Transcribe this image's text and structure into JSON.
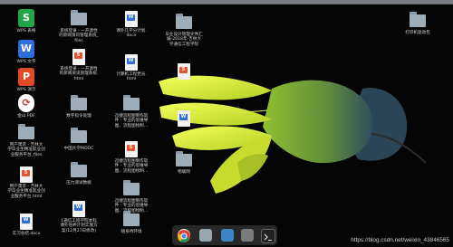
{
  "desktop": {
    "icons": [
      {
        "label": "WPS 表格",
        "type": "app",
        "color": "#22a447",
        "glyph": "S"
      },
      {
        "label": "WPS 文字",
        "type": "app",
        "color": "#2f6fdc",
        "glyph": "W"
      },
      {
        "label": "WPS 演示",
        "type": "app",
        "color": "#e24b27",
        "glyph": "P"
      },
      {
        "label": "金山 PDF",
        "type": "app",
        "color": "#d9322e",
        "glyph": "⟳"
      },
      {
        "label": "用户需求 - 吉林大\n学毕业生精准就业创\n业服务平台_files",
        "type": "folder"
      },
      {
        "label": "用户需求 - 吉林大\n学毕业生精准就业创\n业服务平台.html",
        "type": "html"
      },
      {
        "label": "实习总结.docx",
        "type": "word"
      },
      {
        "label": "系统登录 - 一开源性\n的新闻资讯管理系统_\nfiles",
        "type": "folder"
      },
      {
        "label": "系统登录 - 一开源性\n的新闻资讯管理系统.\nhtml",
        "type": "html"
      },
      {
        "label": "数字指令处理",
        "type": "folder"
      },
      {
        "label": "中国大学MOOC",
        "type": "folder"
      },
      {
        "label": "压力测试数据",
        "type": "folder"
      },
      {
        "label": "1通信工程学院本科\n课外培养计划实施方\n案(12月27日修改)",
        "type": "word"
      },
      {
        "label": "课外几学分计划.\ndocx",
        "type": "word"
      },
      {
        "label": "计算机工程党员.\nhtml",
        "type": "html"
      },
      {
        "label": "迅捷流程图制作软\n件 - 专业的思维导\n图、流程图绘制...",
        "type": "folder"
      },
      {
        "label": "迅捷流程图制作软\n件 - 专业的思维导\n图、流程图绘制...",
        "type": "html"
      },
      {
        "label": "迅捷流程图制作软\n件 - 专业的思维导\n图、流程图绘制...",
        "type": "folder"
      },
      {
        "label": "随身待环境",
        "type": "folder"
      },
      {
        "label": "毕业设计管理文件汇\n编-2018年-吉林大\n学通信工程学院",
        "type": "folder"
      },
      {
        "label": "物联网",
        "type": "folder"
      },
      {
        "label": "打印机驱动包",
        "type": "folder"
      }
    ]
  },
  "dock": {
    "items": [
      {
        "name": "chrome",
        "color": "#e8e8e8"
      },
      {
        "name": "trash",
        "color": "#9aa6ad"
      },
      {
        "name": "monitor",
        "color": "#3d85c6"
      },
      {
        "name": "files",
        "color": "#7b7b7b"
      },
      {
        "name": "terminal",
        "color": "#222222"
      }
    ]
  },
  "watermark": "https://blog.csdn.net/weixin_43846565"
}
